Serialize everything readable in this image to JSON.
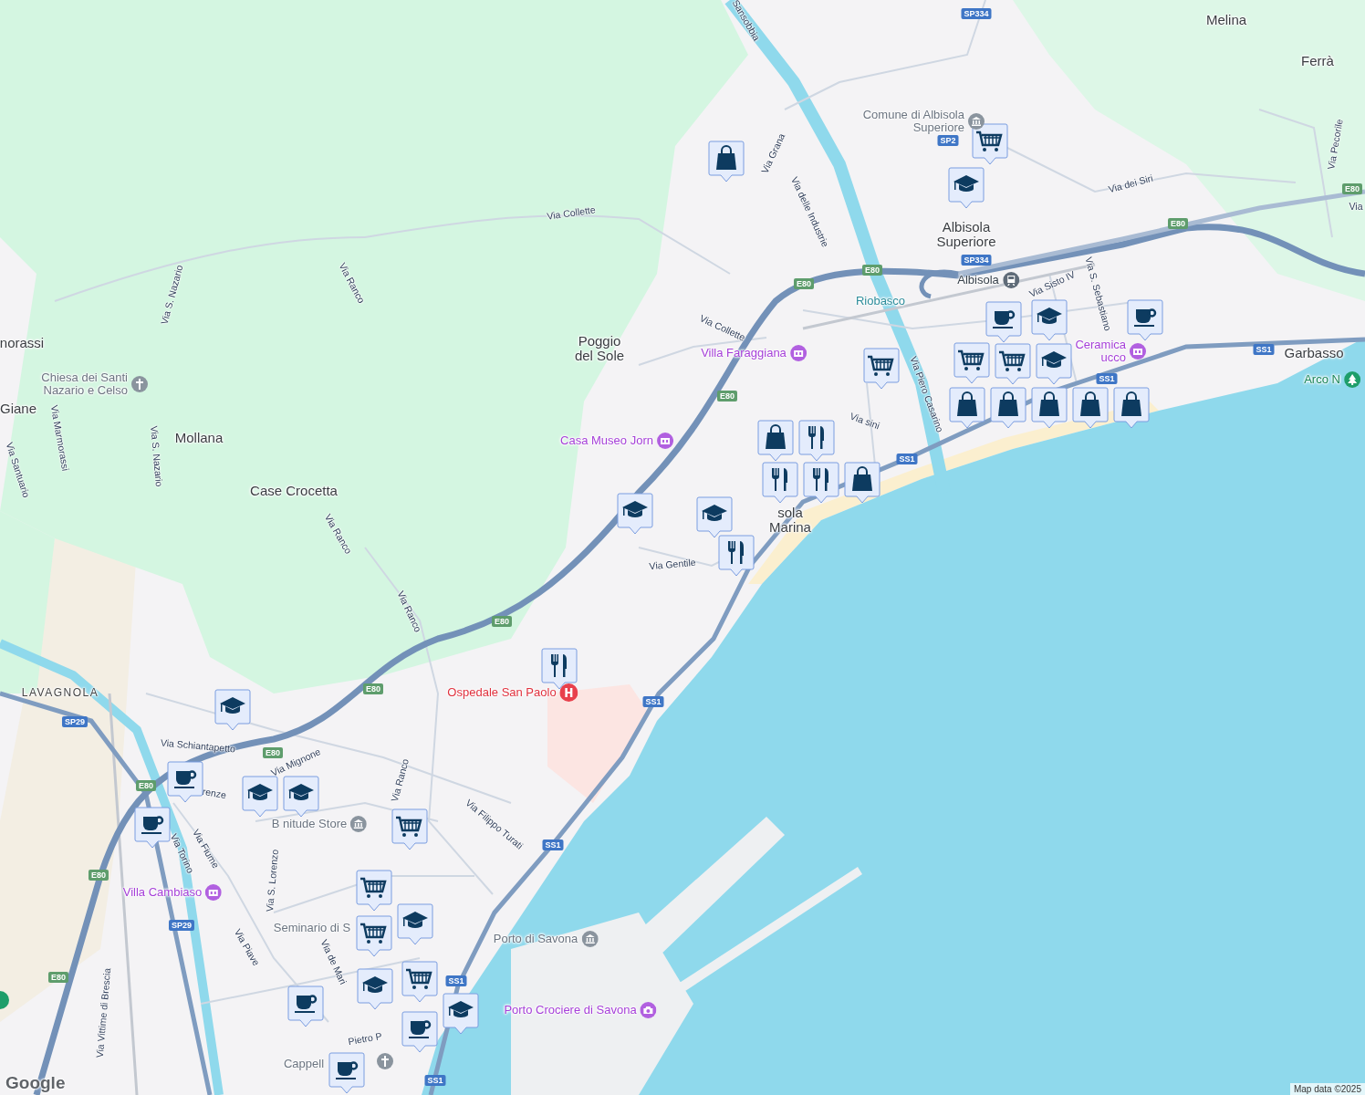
{
  "place_labels": [
    {
      "text": "Melina",
      "kind": "town"
    },
    {
      "text": "Ferrà",
      "kind": "town"
    },
    {
      "text": "Albisola Superiore",
      "kind": "town"
    },
    {
      "text": "norassi",
      "kind": "town"
    },
    {
      "text": "Poggio del Sole",
      "kind": "town"
    },
    {
      "text": "Garbasso",
      "kind": "town"
    },
    {
      "text": "Giane",
      "kind": "town"
    },
    {
      "text": "Mollana",
      "kind": "town"
    },
    {
      "text": "Case Crocetta",
      "kind": "town"
    },
    {
      "text": "sola Marina",
      "kind": "town"
    },
    {
      "text": "LAVAGNOLA",
      "kind": "district"
    }
  ],
  "street_labels": [
    {
      "text": "Sansobbia"
    },
    {
      "text": "Via Collette"
    },
    {
      "text": "Via Ranco"
    },
    {
      "text": "Via S. Nazario"
    },
    {
      "text": "Via Marmorassi"
    },
    {
      "text": "Via S. Nazario"
    },
    {
      "text": "Via Santuario"
    },
    {
      "text": "Via Grana"
    },
    {
      "text": "Via delle Industrie"
    },
    {
      "text": "Via dei Siri"
    },
    {
      "text": "Via Pecorile"
    },
    {
      "text": "Via"
    },
    {
      "text": "Via Collette"
    },
    {
      "text": "Via Sisto IV"
    },
    {
      "text": "Via S. Sebastiano"
    },
    {
      "text": "Via Piero Casarino"
    },
    {
      "text": "Via sini"
    },
    {
      "text": "Via Gentile"
    },
    {
      "text": "Via Ranco"
    },
    {
      "text": "Via Ranco"
    },
    {
      "text": "Via Schiantapetto"
    },
    {
      "text": "Via Mignone"
    },
    {
      "text": "renze"
    },
    {
      "text": "Via Ranco"
    },
    {
      "text": "Via Filippo Turati"
    },
    {
      "text": "Via Torino"
    },
    {
      "text": "Via Fiume"
    },
    {
      "text": "Via S. Lorenzo"
    },
    {
      "text": "Via Piave"
    },
    {
      "text": "Via de Mari"
    },
    {
      "text": "Via Vittime di Brescia"
    },
    {
      "text": "Pietro P"
    }
  ],
  "points_of_interest": [
    {
      "text": "Comune di Albisola Superiore",
      "kind": "town-hall"
    },
    {
      "text": "Chiesa dei Santi Nazario e Celso",
      "kind": "church"
    },
    {
      "text": "Villa Faraggiana",
      "kind": "museum"
    },
    {
      "text": "Casa Museo Jorn",
      "kind": "museum"
    },
    {
      "text": "Riobasco",
      "kind": "locality"
    },
    {
      "text": "Albisola",
      "kind": "station"
    },
    {
      "text": "Ceramica ucco",
      "kind": "museum"
    },
    {
      "text": "Arco N",
      "kind": "park"
    },
    {
      "text": "Ospedale San Paolo",
      "kind": "hospital"
    },
    {
      "text": "Villa Cambiaso",
      "kind": "museum"
    },
    {
      "text": "B nitude Store",
      "kind": "town-hall"
    },
    {
      "text": "Seminario di S",
      "kind": "place"
    },
    {
      "text": "Porto di Savona",
      "kind": "town-hall"
    },
    {
      "text": "Porto Crociere di Savona",
      "kind": "attraction"
    },
    {
      "text": "Cappell",
      "kind": "place"
    }
  ],
  "route_shields": [
    {
      "text": "SP334",
      "kind": "national"
    },
    {
      "text": "SP334",
      "kind": "national"
    },
    {
      "text": "SP2",
      "kind": "national"
    },
    {
      "text": "E80",
      "kind": "european"
    },
    {
      "text": "E80",
      "kind": "european"
    },
    {
      "text": "E80",
      "kind": "european"
    },
    {
      "text": "E80",
      "kind": "european"
    },
    {
      "text": "E80",
      "kind": "european"
    },
    {
      "text": "E80",
      "kind": "european"
    },
    {
      "text": "E80",
      "kind": "european"
    },
    {
      "text": "E80",
      "kind": "european"
    },
    {
      "text": "E80",
      "kind": "european"
    },
    {
      "text": "E80",
      "kind": "european"
    },
    {
      "text": "E80",
      "kind": "european"
    },
    {
      "text": "SS1",
      "kind": "national"
    },
    {
      "text": "SS1",
      "kind": "national"
    },
    {
      "text": "SS1",
      "kind": "national"
    },
    {
      "text": "SS1",
      "kind": "national"
    },
    {
      "text": "SS1",
      "kind": "national"
    },
    {
      "text": "SS1",
      "kind": "national"
    },
    {
      "text": "SS1",
      "kind": "national"
    },
    {
      "text": "SP29",
      "kind": "national"
    },
    {
      "text": "SP29",
      "kind": "national"
    }
  ],
  "attribution": "Map data ©2025",
  "logo": "Google"
}
